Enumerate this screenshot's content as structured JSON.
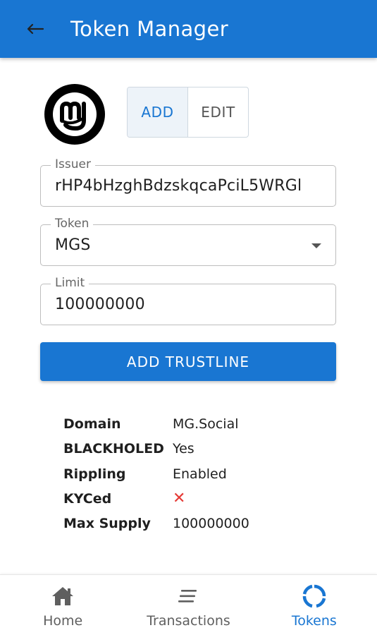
{
  "header": {
    "title": "Token Manager",
    "back_icon": "arrow-left-icon",
    "bg_color": "#1976d2"
  },
  "mode_toggle": {
    "options": [
      {
        "label": "ADD",
        "active": true
      },
      {
        "label": "EDIT",
        "active": false
      }
    ]
  },
  "form": {
    "issuer": {
      "label": "Issuer",
      "value": "rHP4bHzghBdzskqcaPciL5WRGl"
    },
    "token": {
      "label": "Token",
      "value": "MGS"
    },
    "limit": {
      "label": "Limit",
      "value": "100000000"
    }
  },
  "primary_action": {
    "label": "ADD TRUSTLINE"
  },
  "token_info": {
    "domain": {
      "key": "Domain",
      "value": "MG.Social"
    },
    "blackholed": {
      "key": "BLACKHOLED",
      "value": "Yes"
    },
    "rippling": {
      "key": "Rippling",
      "value": "Enabled"
    },
    "kyced": {
      "key": "KYCed",
      "value": "✕",
      "icon": "red-x-icon",
      "color": "#e53935"
    },
    "max_supply": {
      "key": "Max Supply",
      "value": "100000000"
    }
  },
  "bottom_nav": {
    "items": [
      {
        "label": "Home",
        "icon": "home-icon",
        "active": false
      },
      {
        "label": "Transactions",
        "icon": "transactions-icon",
        "active": false
      },
      {
        "label": "Tokens",
        "icon": "tokens-icon",
        "active": true
      }
    ],
    "active_color": "#1976d2"
  }
}
